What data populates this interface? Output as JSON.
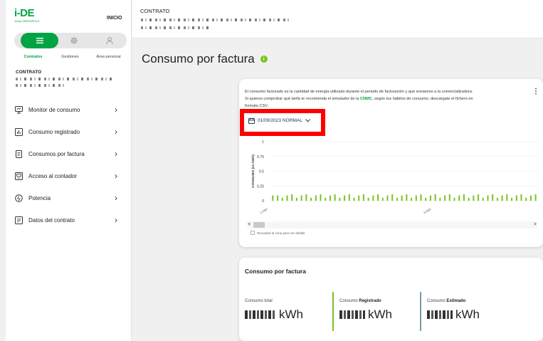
{
  "colors": {
    "brand": "#00a443",
    "chart_green": "#7cc21e",
    "estimated_bar": "#7a9aa6",
    "highlight": "#ff0000"
  },
  "sidebar": {
    "logo": {
      "main": "i-DE",
      "sub": "Grupo IBERDROLA"
    },
    "inicio": "INICIO",
    "segments": [
      {
        "icon": "list-icon",
        "label": "Contratos",
        "active": true
      },
      {
        "icon": "gear-icon",
        "label": "Gestiones",
        "active": false
      },
      {
        "icon": "user-icon",
        "label": "Área personal",
        "active": false
      }
    ],
    "contract_title": "CONTRATO",
    "menu": [
      {
        "icon": "monitor-icon",
        "label": "Monitor de consumo"
      },
      {
        "icon": "bar-chart-icon",
        "label": "Consumo registrado"
      },
      {
        "icon": "invoice-icon",
        "label": "Consumos por factura"
      },
      {
        "icon": "meter-icon",
        "label": "Acceso al contador"
      },
      {
        "icon": "power-icon",
        "label": "Potencia"
      },
      {
        "icon": "contract-icon",
        "label": "Datos del contrato"
      }
    ],
    "chevron": "›"
  },
  "topbar": {
    "label": "CONTRATO"
  },
  "main": {
    "title": "Consumo por factura",
    "info_icon": "i",
    "card1": {
      "text_1": "El consumo facturado es la cantidad de energía utilizado durante el periodo de facturación y que enviamos a la comercializadora.",
      "text_2a": "Si quieres comprobar qué tarifa te recomienda el simulador de la ",
      "text_link": "CNMC",
      "text_2b": ", según tus hábitos de consumo, descárgate el fichero en",
      "text_3": "formato CSV.",
      "kebab": "⋮",
      "date_selector": "01/09/2023 NORMAL",
      "hint": "Recuadra la zona para ver detalle",
      "scroll_left": "<",
      "scroll_right": ">"
    },
    "card2": {
      "title": "Consumo por factura",
      "kpis": [
        {
          "label_plain": "Consumo total",
          "label_bold": "",
          "unit": "kWh"
        },
        {
          "label_plain": "Consumo ",
          "label_bold": "Registrado",
          "unit": "kWh"
        },
        {
          "label_plain": "Consumo ",
          "label_bold": "Estimado",
          "unit": "kWh"
        }
      ]
    }
  },
  "chart_data": {
    "type": "bar",
    "ylabel": "CONSUMO (en kWh)",
    "ylim": [
      0,
      1
    ],
    "yticks": [
      "0",
      "0.25",
      "0.5",
      "0.75",
      "1"
    ],
    "x_tick_labels": [
      "2 Ago",
      "9 Ago"
    ],
    "series": [
      {
        "values": [
          0.09,
          0.09,
          0.05,
          0.09,
          0.11,
          0.05,
          0.09,
          0.11,
          0.05,
          0.09,
          0.11,
          0.05,
          0.09,
          0.11,
          0.05,
          0.09,
          0.11,
          0.05,
          0.09,
          0.11,
          0.05,
          0.09,
          0.11,
          0.05,
          0.09,
          0.11,
          0.05,
          0.09,
          0.11,
          0.05,
          0.09,
          0.11,
          0.05,
          0.09,
          0.11,
          0.05,
          0.09,
          0.11,
          0.05,
          0.09,
          0.11,
          0.05,
          0.09,
          0.11,
          0.05,
          0.09,
          0.11,
          0.05,
          0.09,
          0.11,
          0.05,
          0.09,
          0.11,
          0.05,
          0.09,
          0.11
        ]
      }
    ]
  }
}
